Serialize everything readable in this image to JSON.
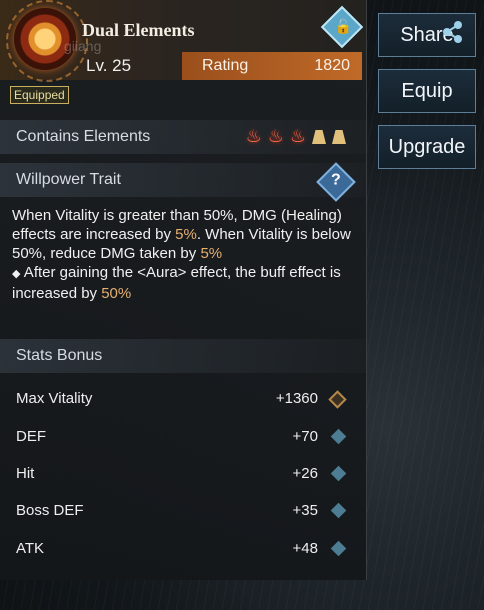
{
  "item": {
    "name": "Dual Elements",
    "watermark": "giiang",
    "level": "Lv. 25",
    "rating_label": "Rating",
    "rating_value": "1820",
    "equipped_badge": "Equipped"
  },
  "elements_section": {
    "title": "Contains Elements",
    "icons": [
      "fire-element-icon",
      "fire-element-icon",
      "fire-element-icon",
      "earth-element-icon",
      "earth-element-icon"
    ]
  },
  "willpower": {
    "title": "Willpower Trait",
    "line1_a": "When Vitality is greater than 50%, DMG (Healing) effects are increased by ",
    "line1_val": "5%",
    "line1_b": ". When Vitality is below 50%, reduce DMG taken by ",
    "line1_val2": "5%",
    "bullet": "◆",
    "line2_a": " After gaining the <Aura> effect, the buff effect is increased by ",
    "line2_val": "50%"
  },
  "stats": {
    "title": "Stats Bonus",
    "rows": [
      {
        "name": "Max Vitality",
        "value": "+1360"
      },
      {
        "name": "DEF",
        "value": "+70"
      },
      {
        "name": "Hit",
        "value": "+26"
      },
      {
        "name": "Boss DEF",
        "value": "+35"
      },
      {
        "name": "ATK",
        "value": "+48"
      }
    ]
  },
  "actions": {
    "share": "Share",
    "equip": "Equip",
    "upgrade": "Upgrade"
  },
  "colors": {
    "highlight": "#e6b070",
    "rating_bar": "#c06a28",
    "button_border": "#5c7e96"
  }
}
